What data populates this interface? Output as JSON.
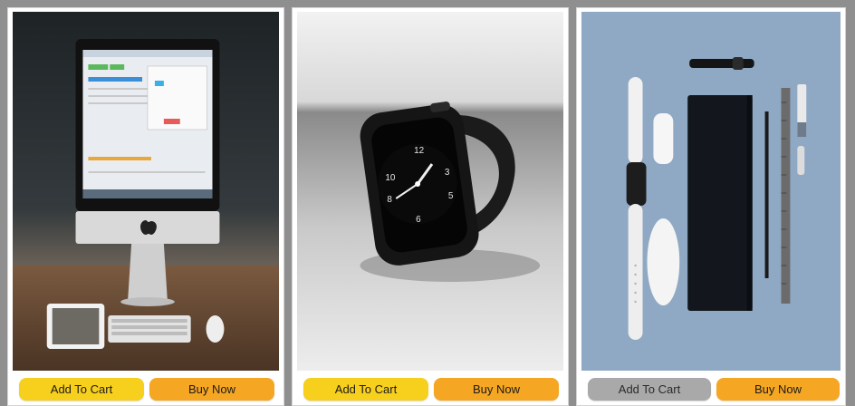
{
  "products": [
    {
      "image_icon": "imac-desk-image",
      "add_to_cart_label": "Add To Cart",
      "buy_now_label": "Buy Now"
    },
    {
      "image_icon": "smartwatch-image",
      "add_to_cart_label": "Add To Cart",
      "buy_now_label": "Buy Now"
    },
    {
      "image_icon": "accessories-flatlay-image",
      "add_to_cart_label": "Add To Cart",
      "buy_now_label": "Buy Now"
    }
  ],
  "colors": {
    "add_to_cart": "#f7cf1d",
    "buy_now": "#f5a623",
    "add_to_cart_disabled": "#a9a9a9"
  }
}
